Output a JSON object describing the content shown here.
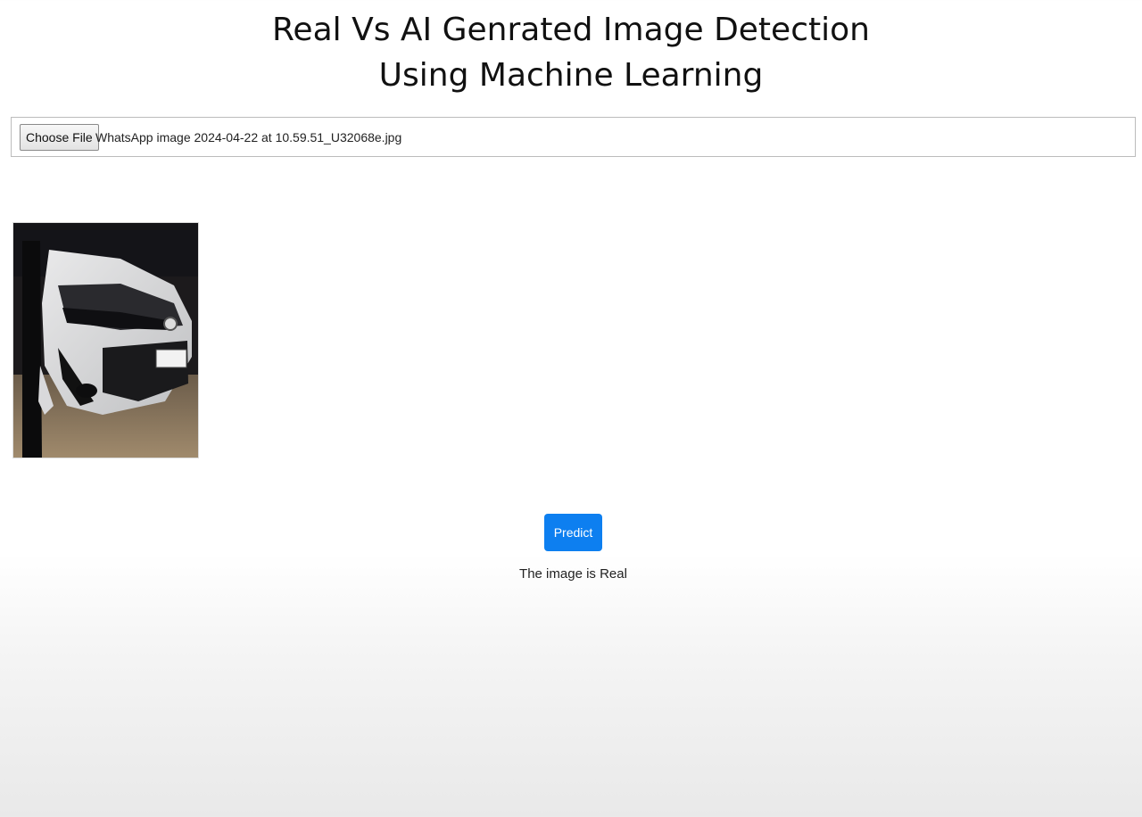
{
  "header": {
    "title_line1": "Real Vs AI Genrated Image Detection",
    "title_line2": "Using Machine Learning"
  },
  "upload": {
    "button_label": "Choose File",
    "file_name": "WhatsApp image 2024-04-22 at 10.59.51_U32068e.jpg"
  },
  "preview": {
    "description_icon": "car-photo"
  },
  "actions": {
    "predict_label": "Predict"
  },
  "result": {
    "text": "The image is Real"
  },
  "colors": {
    "accent": "#0d7ff0",
    "background": "#ffffff"
  }
}
